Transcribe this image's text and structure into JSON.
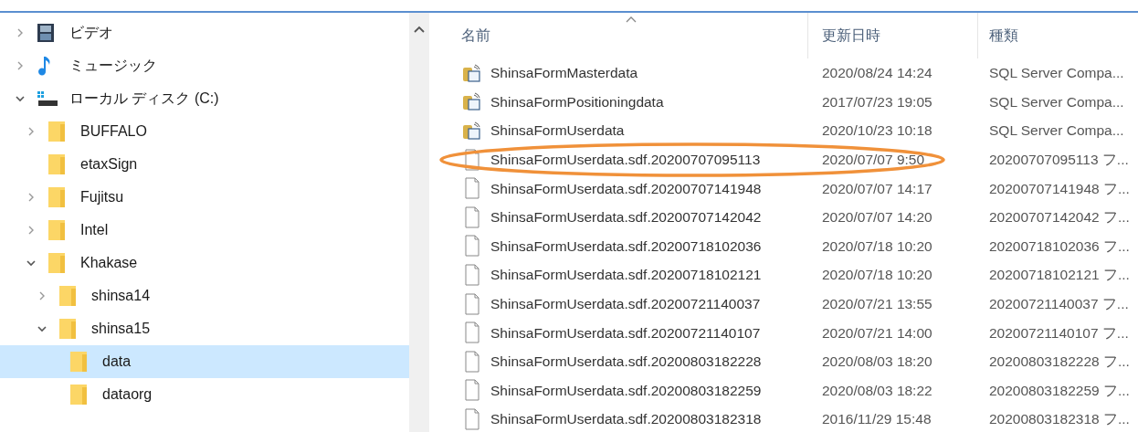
{
  "nav_tree": [
    {
      "label": "ビデオ",
      "kind": "video",
      "expanded": false,
      "selected": false
    },
    {
      "label": "ミュージック",
      "kind": "music",
      "expanded": false,
      "selected": false
    },
    {
      "label": "ローカル ディスク (C:)",
      "kind": "drive",
      "expanded": true,
      "selected": false,
      "children": [
        {
          "label": "BUFFALO",
          "kind": "folder",
          "expanded": false,
          "selected": false
        },
        {
          "label": "etaxSign",
          "kind": "folder",
          "selected": false
        },
        {
          "label": "Fujitsu",
          "kind": "folder",
          "expanded": false,
          "selected": false
        },
        {
          "label": "Intel",
          "kind": "folder",
          "expanded": false,
          "selected": false
        },
        {
          "label": "Khakase",
          "kind": "folder",
          "expanded": true,
          "selected": false,
          "children": [
            {
              "label": "shinsa14",
              "kind": "folder",
              "expanded": false,
              "selected": false
            },
            {
              "label": "shinsa15",
              "kind": "folder",
              "expanded": true,
              "selected": false,
              "children": [
                {
                  "label": "data",
                  "kind": "folder",
                  "selected": true
                },
                {
                  "label": "dataorg",
                  "kind": "folder",
                  "selected": false
                }
              ]
            }
          ]
        }
      ]
    }
  ],
  "file_list": {
    "columns": [
      "名前",
      "更新日時",
      "種類"
    ],
    "rows": [
      {
        "kind": "database",
        "name": "ShinsaFormMasterdata",
        "modified": "2020/08/24 14:24",
        "type": "SQL Server Compa...",
        "circled": false
      },
      {
        "kind": "database",
        "name": "ShinsaFormPositioningdata",
        "modified": "2017/07/23 19:05",
        "type": "SQL Server Compa...",
        "circled": false
      },
      {
        "kind": "database",
        "name": "ShinsaFormUserdata",
        "modified": "2020/10/23 10:18",
        "type": "SQL Server Compa...",
        "circled": false
      },
      {
        "kind": "file",
        "name": "ShinsaFormUserdata.sdf.20200707095113",
        "modified": "2020/07/07 9:50",
        "type": "20200707095113 フ...",
        "circled": true
      },
      {
        "kind": "file",
        "name": "ShinsaFormUserdata.sdf.20200707141948",
        "modified": "2020/07/07 14:17",
        "type": "20200707141948 フ...",
        "circled": false
      },
      {
        "kind": "file",
        "name": "ShinsaFormUserdata.sdf.20200707142042",
        "modified": "2020/07/07 14:20",
        "type": "20200707142042 フ...",
        "circled": false
      },
      {
        "kind": "file",
        "name": "ShinsaFormUserdata.sdf.20200718102036",
        "modified": "2020/07/18 10:20",
        "type": "20200718102036 フ...",
        "circled": false
      },
      {
        "kind": "file",
        "name": "ShinsaFormUserdata.sdf.20200718102121",
        "modified": "2020/07/18 10:20",
        "type": "20200718102121 フ...",
        "circled": false
      },
      {
        "kind": "file",
        "name": "ShinsaFormUserdata.sdf.20200721140037",
        "modified": "2020/07/21 13:55",
        "type": "20200721140037 フ...",
        "circled": false
      },
      {
        "kind": "file",
        "name": "ShinsaFormUserdata.sdf.20200721140107",
        "modified": "2020/07/21 14:00",
        "type": "20200721140107 フ...",
        "circled": false
      },
      {
        "kind": "file",
        "name": "ShinsaFormUserdata.sdf.20200803182228",
        "modified": "2020/08/03 18:20",
        "type": "20200803182228 フ...",
        "circled": false
      },
      {
        "kind": "file",
        "name": "ShinsaFormUserdata.sdf.20200803182259",
        "modified": "2020/08/03 18:22",
        "type": "20200803182259 フ...",
        "circled": false
      },
      {
        "kind": "file",
        "name": "ShinsaFormUserdata.sdf.20200803182318",
        "modified": "2016/11/29 15:48",
        "type": "20200803182318 フ...",
        "circled": false
      }
    ]
  }
}
